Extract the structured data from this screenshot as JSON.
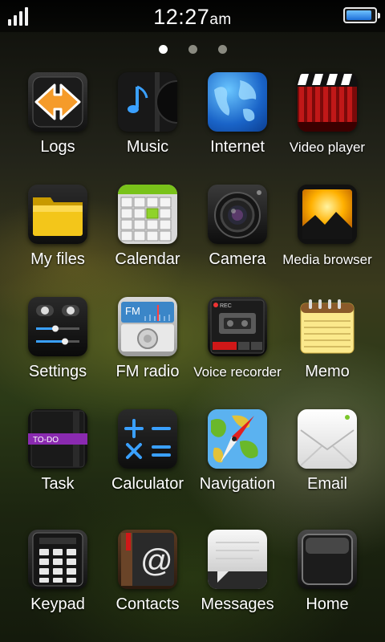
{
  "status": {
    "time": "12:27",
    "ampm": "am",
    "battery_level": 0.9,
    "signal_bars": 4
  },
  "pager": {
    "pages": 3,
    "active": 0
  },
  "apps": [
    {
      "label": "Logs",
      "icon": "logs-icon"
    },
    {
      "label": "Music",
      "icon": "music-icon"
    },
    {
      "label": "Internet",
      "icon": "internet-icon"
    },
    {
      "label": "Video player",
      "icon": "video-player-icon"
    },
    {
      "label": "My files",
      "icon": "folder-icon"
    },
    {
      "label": "Calendar",
      "icon": "calendar-icon"
    },
    {
      "label": "Camera",
      "icon": "camera-icon"
    },
    {
      "label": "Media browser",
      "icon": "media-browser-icon"
    },
    {
      "label": "Settings",
      "icon": "settings-icon"
    },
    {
      "label": "FM radio",
      "icon": "fm-radio-icon"
    },
    {
      "label": "Voice recorder",
      "icon": "voice-recorder-icon"
    },
    {
      "label": "Memo",
      "icon": "memo-icon"
    },
    {
      "label": "Task",
      "icon": "task-icon"
    },
    {
      "label": "Calculator",
      "icon": "calculator-icon"
    },
    {
      "label": "Navigation",
      "icon": "navigation-icon"
    },
    {
      "label": "Email",
      "icon": "email-icon"
    }
  ],
  "dock": [
    {
      "label": "Keypad",
      "icon": "keypad-icon"
    },
    {
      "label": "Contacts",
      "icon": "contacts-icon"
    },
    {
      "label": "Messages",
      "icon": "messages-icon"
    },
    {
      "label": "Home",
      "icon": "home-icon"
    }
  ],
  "icon_text": {
    "fm": "FM",
    "todo": "TO-DO",
    "rec": "REC"
  }
}
